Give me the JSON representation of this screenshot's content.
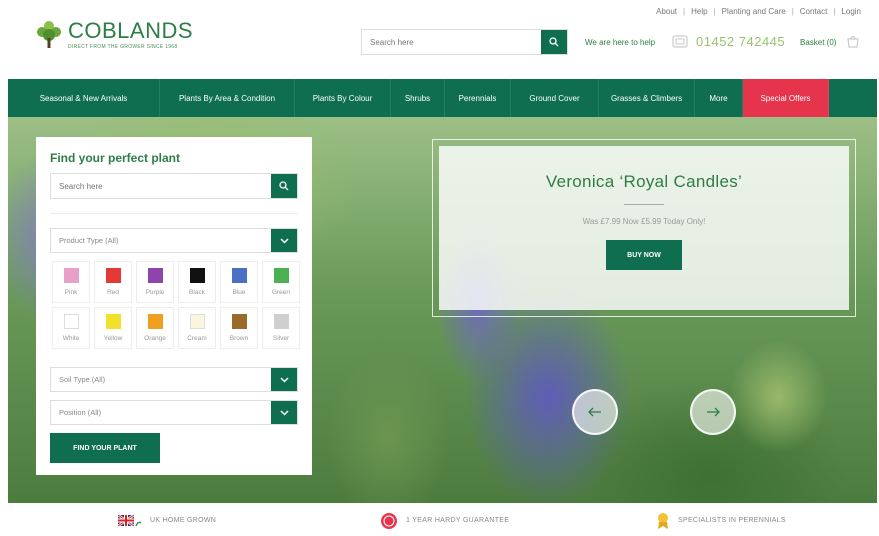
{
  "util_links": [
    "About",
    "Help",
    "Planting and Care",
    "Contact",
    "Login"
  ],
  "header": {
    "logo_text": "COBLANDS",
    "logo_tagline": "DIRECT FROM THE GROWER SINCE 1968",
    "search_placeholder": "Search here",
    "help_text": "We are here to help",
    "phone": "01452 742445",
    "basket": "Basket (0)"
  },
  "nav": [
    "Seasonal & New Arrivals",
    "Plants By Area & Condition",
    "Plants By Colour",
    "Shrubs",
    "Perennials",
    "Ground Cover",
    "Grasses & Climbers",
    "More",
    "Special Offers"
  ],
  "finder": {
    "title": "Find your perfect plant",
    "search_placeholder": "Search here",
    "product_type": "Product Type (All)",
    "colours": [
      {
        "name": "Pink",
        "color": "#e8a0c8"
      },
      {
        "name": "Red",
        "color": "#e53935"
      },
      {
        "name": "Purple",
        "color": "#8e44ad"
      },
      {
        "name": "Black",
        "color": "#111111"
      },
      {
        "name": "Blue",
        "color": "#4a6fc4"
      },
      {
        "name": "Green",
        "color": "#4caf50"
      },
      {
        "name": "White",
        "color": "#ffffff"
      },
      {
        "name": "Yellow",
        "color": "#f2e12a"
      },
      {
        "name": "Orange",
        "color": "#f0a020"
      },
      {
        "name": "Cream",
        "color": "#faf5dc"
      },
      {
        "name": "Brown",
        "color": "#9a6a2a"
      },
      {
        "name": "Silver",
        "color": "#cfcfcf"
      }
    ],
    "soil_type": "Soil Type (All)",
    "position": "Position (All)",
    "button": "FIND YOUR PLANT"
  },
  "promo": {
    "title": "Veronica ‘Royal Candles’",
    "price": "Was £7.99 Now £5.99 Today Only!",
    "button": "BUY NOW"
  },
  "usps": [
    "UK HOME GROWN",
    "1 YEAR HARDY GUARANTEE",
    "SPECIALISTS IN PERENNIALS"
  ],
  "colors": {
    "brand_green": "#0e6e4f",
    "special_red": "#e5344c",
    "phone_green": "#9ac36c"
  }
}
